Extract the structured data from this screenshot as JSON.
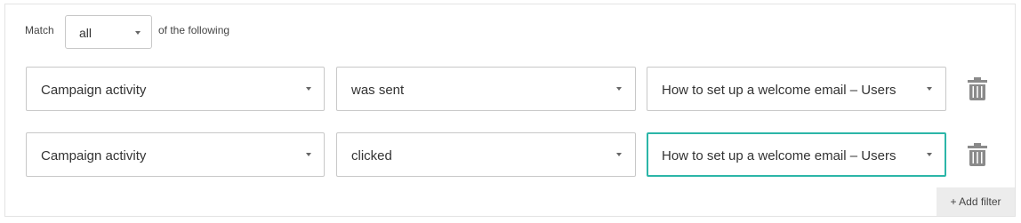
{
  "match": {
    "label": "Match",
    "selected": "all",
    "suffix": "of the following"
  },
  "filters": [
    {
      "field": "Campaign activity",
      "condition": "was sent",
      "value": "How to set up a welcome email – Users"
    },
    {
      "field": "Campaign activity",
      "condition": "clicked",
      "value": "How to set up a welcome email – Users"
    }
  ],
  "add_filter_label": "+ Add filter",
  "icons": {
    "dropdown": "caret-down-icon",
    "delete": "trash-icon"
  },
  "colors": {
    "focus_border": "#2cb6a8",
    "icon_gray": "#8a8a8a"
  }
}
